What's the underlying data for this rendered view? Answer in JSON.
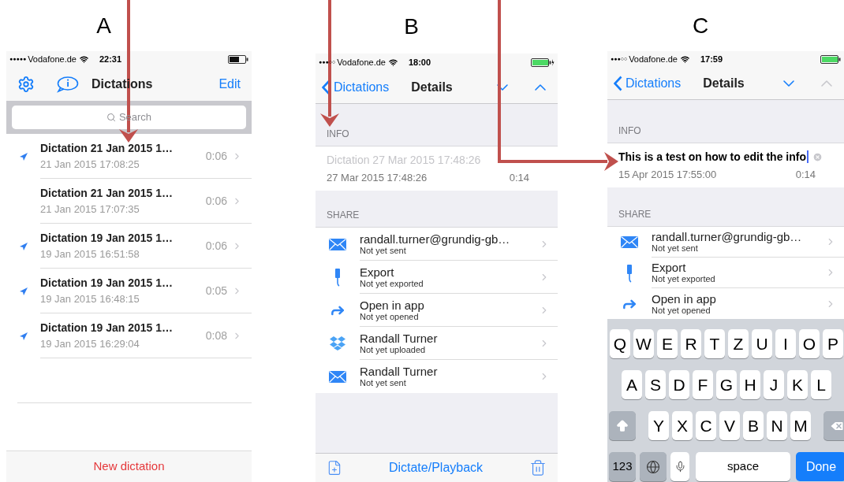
{
  "panels": [
    {
      "kind": "list",
      "label": "A",
      "status_bar": {
        "signal": "●●●●●",
        "carrier": "Vodafone.de",
        "time": "22:31",
        "battery": {
          "charged": false,
          "charging": false
        }
      },
      "nav": {
        "title": "Dictations",
        "action": "Edit"
      },
      "search": {
        "placeholder": "Search"
      },
      "rows": [
        {
          "title": "Dictation 21 Jan 2015 1…",
          "date": "21 Jan 2015 17:08:25",
          "duration": "0:06",
          "sent": true
        },
        {
          "title": "Dictation 21 Jan 2015 1…",
          "date": "21 Jan 2015 17:07:35",
          "duration": "0:06",
          "sent": false
        },
        {
          "title": "Dictation 19 Jan 2015 1…",
          "date": "19 Jan 2015 16:51:58",
          "duration": "0:06",
          "sent": true
        },
        {
          "title": "Dictation 19 Jan 2015 1…",
          "date": "19 Jan 2015 16:48:15",
          "duration": "0:05",
          "sent": true
        },
        {
          "title": "Dictation 19 Jan 2015 1…",
          "date": "19 Jan 2015 16:29:04",
          "duration": "0:08",
          "sent": true
        }
      ],
      "footer": {
        "label": "New dictation"
      }
    },
    {
      "kind": "details",
      "label": "B",
      "status_bar": {
        "signal": "●●●○○",
        "carrier": "Vodafone.de",
        "time": "18:00",
        "battery": {
          "charged": true,
          "charging": true
        }
      },
      "nav": {
        "back": "Dictations",
        "title": "Details",
        "arrows": [
          {
            "kind": "down",
            "disabled": false
          },
          {
            "kind": "up",
            "disabled": false
          }
        ]
      },
      "info": {
        "header": "INFO",
        "title": "Dictation 27 Mar 2015 17:48:26",
        "editing": false,
        "date": "27 Mar 2015 17:48:26",
        "duration": "0:14"
      },
      "share": {
        "header": "SHARE",
        "rows": [
          {
            "kind": "mail",
            "title": "randall.turner@grundig-gb…",
            "status": "Not yet sent"
          },
          {
            "kind": "export",
            "title": "Export",
            "status": "Not yet exported"
          },
          {
            "kind": "open",
            "title": "Open in app",
            "status": "Not yet opened"
          },
          {
            "kind": "dropbox",
            "title": "Randall Turner",
            "status": "Not yet uploaded"
          },
          {
            "kind": "mail",
            "title": "Randall Turner",
            "status": "Not yet sent"
          }
        ]
      },
      "toolbar": {
        "label": "Dictate/Playback"
      }
    },
    {
      "kind": "details",
      "label": "C",
      "status_bar": {
        "signal": "●●●○○",
        "carrier": "Vodafone.de",
        "time": "17:59",
        "battery": {
          "charged": true,
          "charging": false
        }
      },
      "nav": {
        "back": "Dictations",
        "title": "Details",
        "arrows": [
          {
            "kind": "down",
            "disabled": false
          },
          {
            "kind": "up",
            "disabled": true
          }
        ]
      },
      "info": {
        "header": "INFO",
        "title": "This is a test on how to edit the info",
        "editing": true,
        "date": "15 Apr 2015 17:55:00",
        "duration": "0:14"
      },
      "share": {
        "header": "SHARE",
        "rows": [
          {
            "kind": "mail",
            "title": "randall.turner@grundig-gb…",
            "status": "Not yet sent"
          },
          {
            "kind": "export",
            "title": "Export",
            "status": "Not yet exported"
          },
          {
            "kind": "open",
            "title": "Open in app",
            "status": "Not yet opened"
          }
        ]
      },
      "keyboard": {
        "rows": [
          [
            "Q",
            "W",
            "E",
            "R",
            "T",
            "Z",
            "U",
            "I",
            "O",
            "P"
          ],
          [
            "A",
            "S",
            "D",
            "F",
            "G",
            "H",
            "J",
            "K",
            "L"
          ],
          [
            "Y",
            "X",
            "C",
            "V",
            "B",
            "N",
            "M"
          ]
        ],
        "numbers": "123",
        "space": "space",
        "done": "Done"
      }
    }
  ]
}
